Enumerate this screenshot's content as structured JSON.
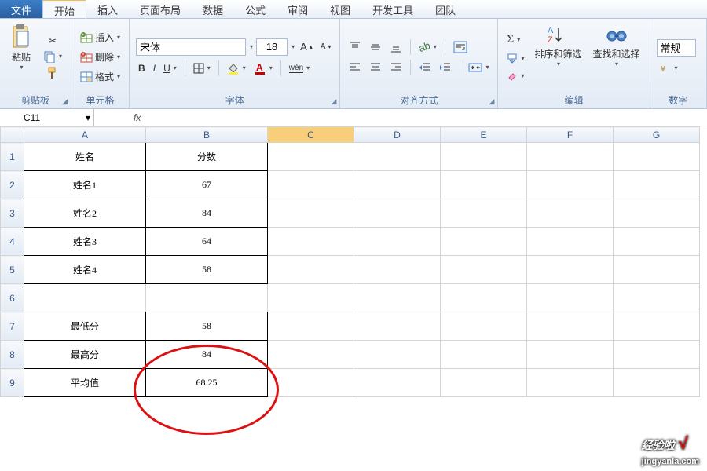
{
  "tabs": {
    "file": "文件",
    "home": "开始",
    "insert": "插入",
    "layout": "页面布局",
    "data": "数据",
    "formulas": "公式",
    "review": "审阅",
    "view": "视图",
    "dev": "开发工具",
    "team": "团队"
  },
  "groups": {
    "clipboard": "剪贴板",
    "cells": "单元格",
    "font": "字体",
    "align": "对齐方式",
    "editing": "编辑",
    "number": "数字"
  },
  "clipboard": {
    "paste": "粘贴"
  },
  "cells": {
    "insert": "插入",
    "delete": "删除",
    "format": "格式"
  },
  "font": {
    "name": "宋体",
    "size": "18",
    "bold": "B",
    "italic": "I",
    "underline": "U",
    "phonetic": "wén"
  },
  "editing": {
    "sort": "排序和筛选",
    "find": "查找和选择"
  },
  "number": {
    "format": "常规"
  },
  "fbar": {
    "name": "C11",
    "fx": "fx",
    "value": ""
  },
  "cols": [
    "A",
    "B",
    "C",
    "D",
    "E",
    "F",
    "G"
  ],
  "rows": [
    "1",
    "2",
    "3",
    "4",
    "5",
    "6",
    "7",
    "8",
    "9"
  ],
  "sheet": {
    "A1": "姓名",
    "B1": "分数",
    "A2": "姓名1",
    "B2": "67",
    "A3": "姓名2",
    "B3": "84",
    "A4": "姓名3",
    "B4": "64",
    "A5": "姓名4",
    "B5": "58",
    "A7": "最低分",
    "B7": "58",
    "A8": "最高分",
    "B8": "84",
    "A9": "平均值",
    "B9": "68.25"
  },
  "watermark": {
    "brand": "经验啦",
    "url": "jingyanla.com"
  }
}
